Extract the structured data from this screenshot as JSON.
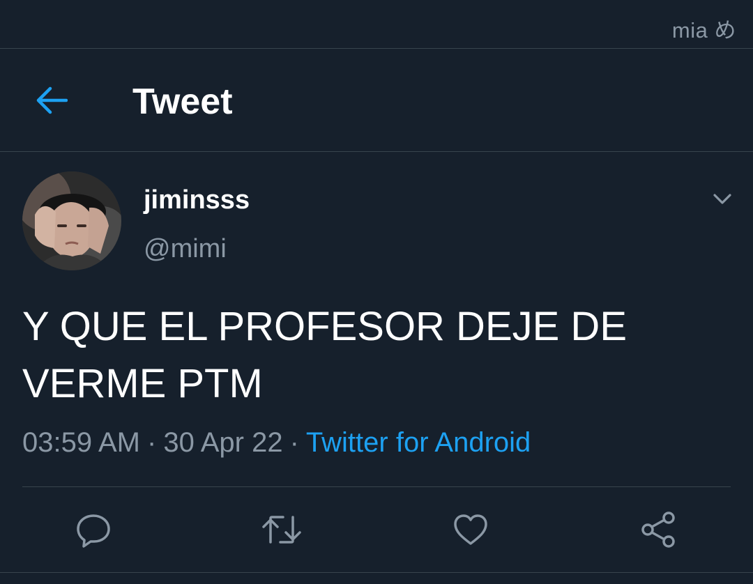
{
  "watermark": "mia め",
  "header": {
    "title": "Tweet"
  },
  "tweet": {
    "display_name": "jiminsss",
    "handle": "@mimi",
    "text": "Y QUE EL PROFESOR DEJE DE VERME PTM",
    "time": "03:59 AM",
    "date": "30 Apr 22",
    "separator": "·",
    "source": "Twitter for Android"
  },
  "icons": {
    "back": "arrow-left-icon",
    "more": "chevron-down-icon",
    "reply": "reply-icon",
    "retweet": "retweet-icon",
    "like": "heart-icon",
    "share": "share-icon"
  },
  "colors": {
    "background": "#16202c",
    "accent": "#1da1f2",
    "secondary_text": "#8b98a5",
    "divider": "#38444d"
  }
}
